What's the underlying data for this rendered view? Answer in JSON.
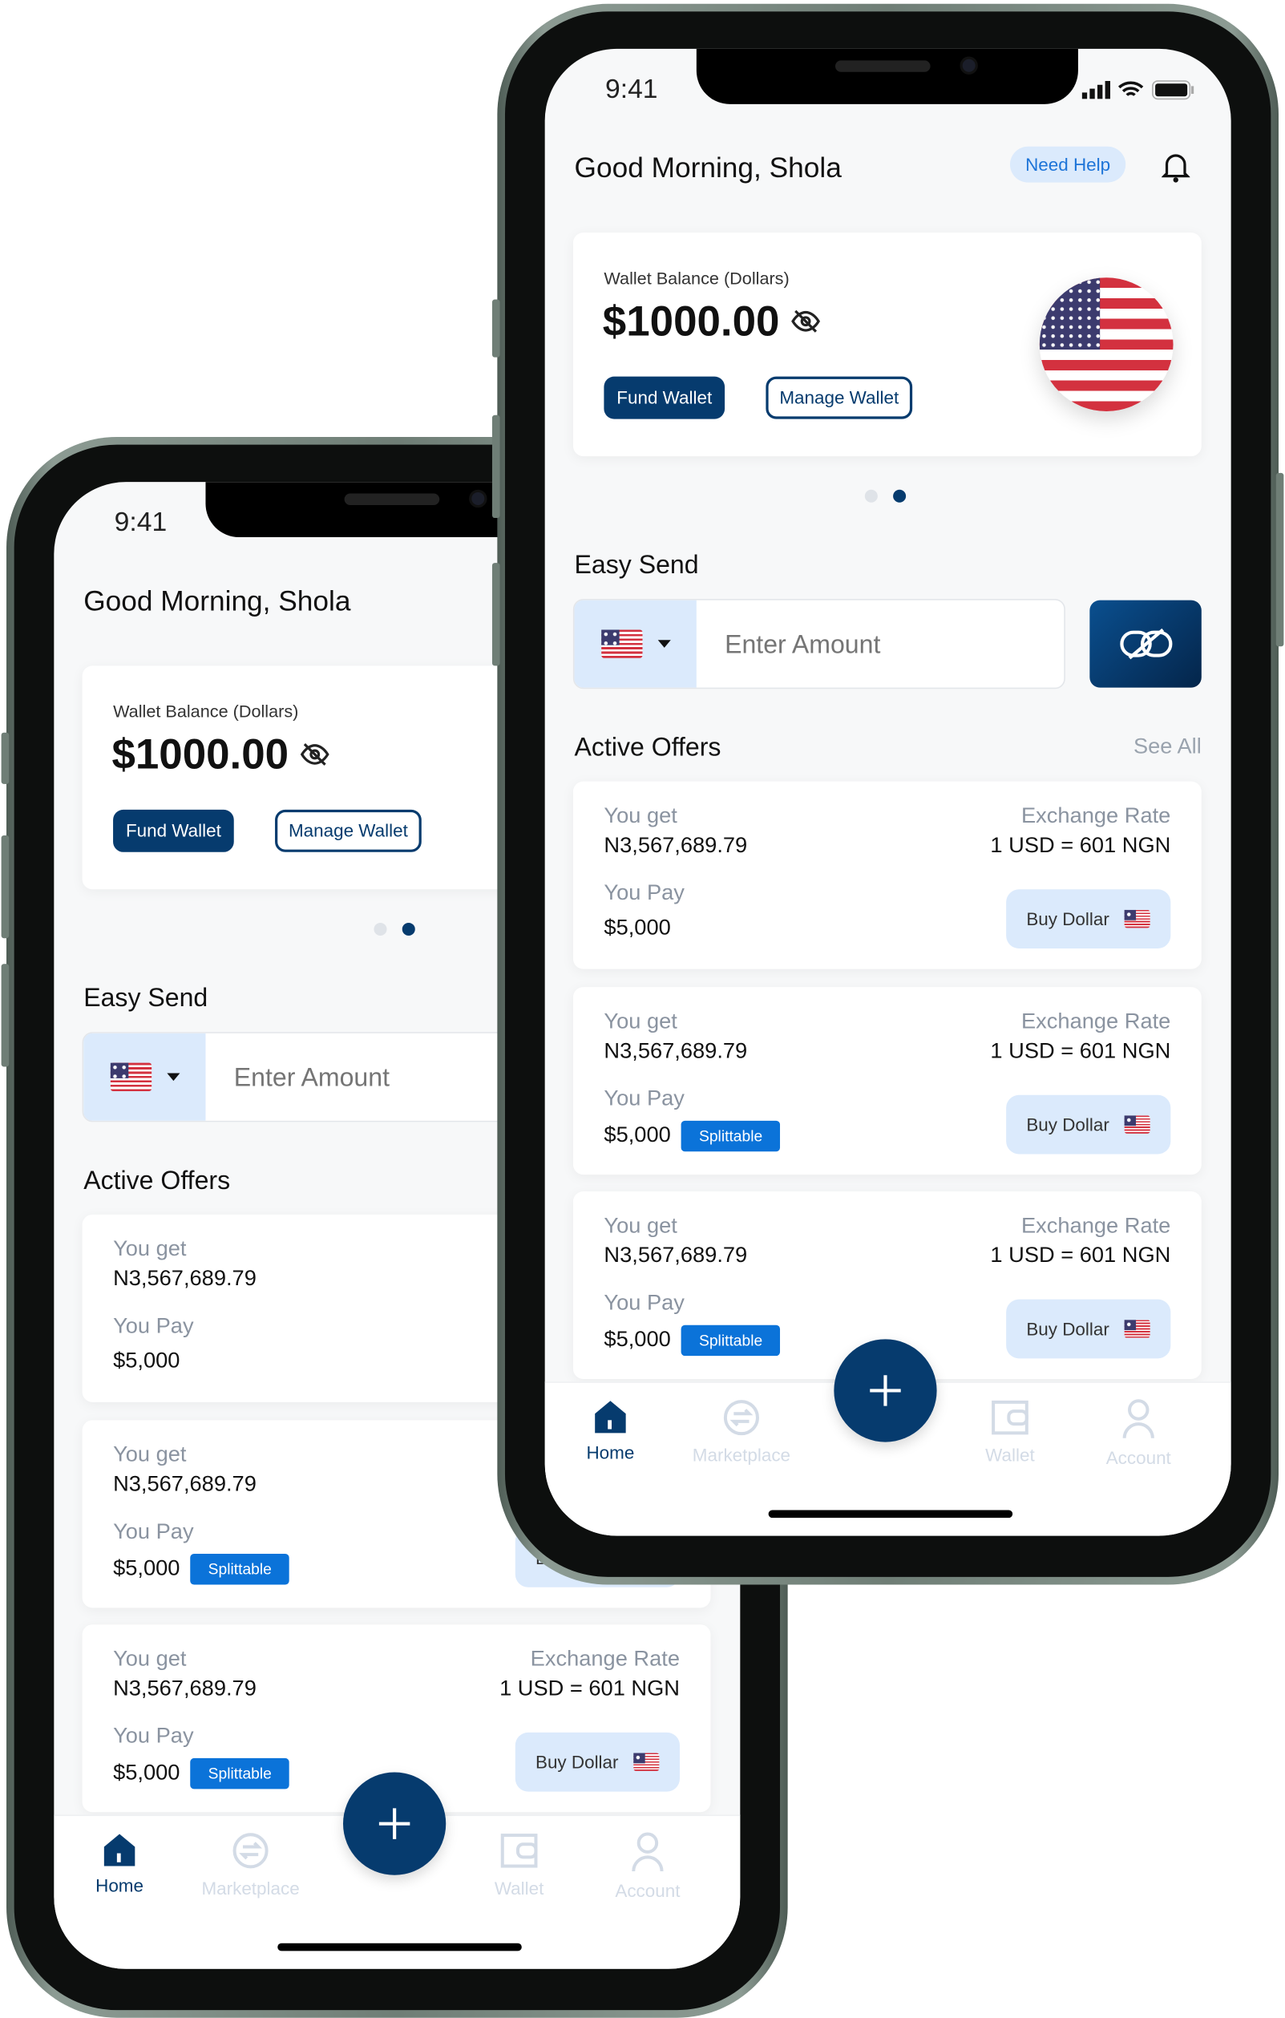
{
  "status": {
    "time": "9:41"
  },
  "header": {
    "greeting": "Good Morning, Shola",
    "help_label": "Need Help"
  },
  "wallet": {
    "label": "Wallet Balance (Dollars)",
    "balance": "$1000.00",
    "fund_label": "Fund Wallet",
    "manage_label": "Manage Wallet",
    "currency_flag": "us-flag",
    "carousel": {
      "pages": 2,
      "active": 2
    }
  },
  "easy_send": {
    "title": "Easy Send",
    "placeholder": "Enter Amount",
    "link_icon": "link-icon"
  },
  "offers": {
    "title": "Active Offers",
    "see_all": "See All",
    "items": [
      {
        "get_label": "You get",
        "get_value": "N3,567,689.79",
        "pay_label": "You Pay",
        "pay_value": "$5,000",
        "rate_label": "Exchange Rate",
        "rate_value": "1 USD = 601 NGN",
        "buy_label": "Buy Dollar",
        "badge": ""
      },
      {
        "get_label": "You get",
        "get_value": "N3,567,689.79",
        "pay_label": "You Pay",
        "pay_value": "$5,000",
        "rate_label": "Exchange Rate",
        "rate_value": "1 USD = 601 NGN",
        "buy_label": "Buy Dollar",
        "badge": "Splittable"
      },
      {
        "get_label": "You get",
        "get_value": "N3,567,689.79",
        "pay_label": "You Pay",
        "pay_value": "$5,000",
        "rate_label": "Exchange Rate",
        "rate_value": "1 USD = 601 NGN",
        "buy_label": "Buy Dollar",
        "badge": "Splittable"
      }
    ]
  },
  "nav": {
    "items": [
      {
        "label": "Home",
        "active": true
      },
      {
        "label": "Marketplace"
      },
      {
        "label": "Wallet"
      },
      {
        "label": "Account"
      }
    ]
  },
  "colors": {
    "primary": "#063b6e",
    "accent": "#0b73d9",
    "light": "#dbeafc"
  }
}
